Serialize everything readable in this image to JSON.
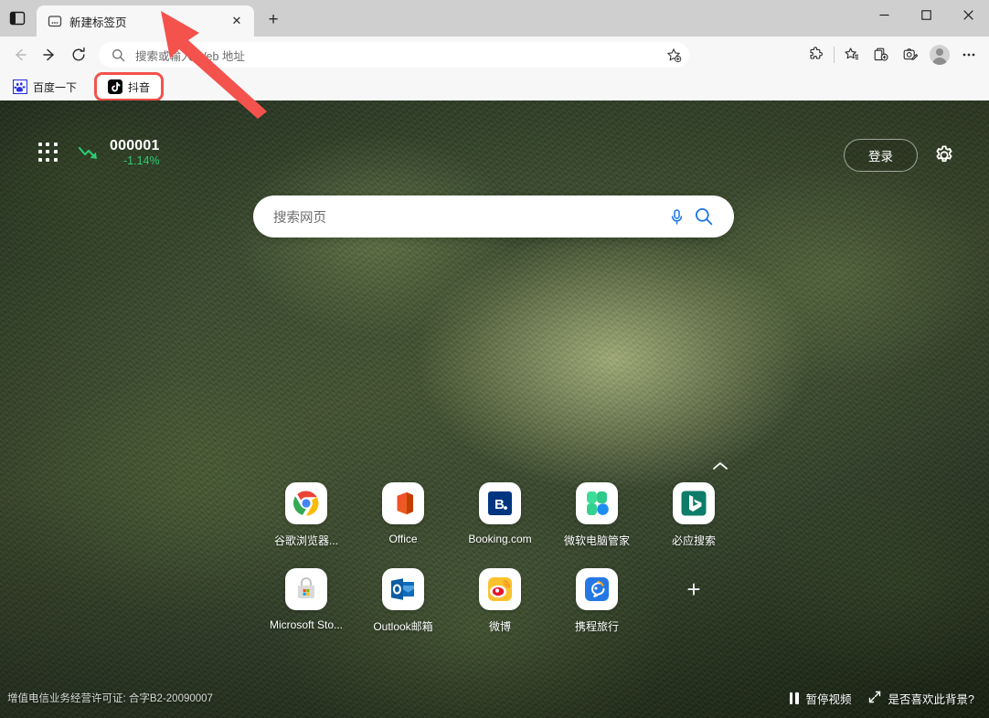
{
  "window": {
    "minimize_label": "–",
    "maximize_label": "□",
    "close_label": "✕"
  },
  "tabstrip": {
    "tab_search_icon": "tab-actions-icon",
    "tabs": [
      {
        "title": "新建标签页",
        "favicon": "new-tab-page-icon",
        "close_label": "✕"
      }
    ],
    "new_tab_label": "+"
  },
  "toolbar": {
    "back_icon": "back-arrow-icon",
    "forward_icon": "forward-arrow-icon",
    "refresh_icon": "refresh-icon",
    "address": {
      "placeholder": "搜索或输入 Web 地址",
      "value": "",
      "search_icon": "search-icon",
      "favorite_icon": "add-favorite-star-icon"
    },
    "right_icons": [
      {
        "name": "extensions-icon"
      },
      {
        "name": "favorites-star-icon"
      },
      {
        "name": "collections-icon"
      },
      {
        "name": "screenshot-icon"
      },
      {
        "name": "profile-avatar"
      },
      {
        "name": "settings-more-icon",
        "label": "⋯"
      }
    ]
  },
  "bookmarks": [
    {
      "label": "百度一下",
      "icon": "baidu-icon",
      "highlighted": false
    },
    {
      "label": "抖音",
      "icon": "douyin-icon",
      "highlighted": true
    }
  ],
  "newtab": {
    "app_grid_icon": "app-grid-icon",
    "ticker": {
      "symbol": "000001",
      "change": "-1.14%",
      "trend": "down",
      "trend_color": "#2ecc71"
    },
    "sign_in_label": "登录",
    "settings_icon": "gear-icon",
    "search": {
      "placeholder": "搜索网页",
      "value": "",
      "mic_icon": "microphone-icon",
      "search_icon": "search-icon",
      "accent_color": "#1a73e8"
    },
    "collapse_icon": "chevron-up-icon",
    "shortcuts": [
      {
        "label": "谷歌浏览器...",
        "icon": "chrome-icon"
      },
      {
        "label": "Office",
        "icon": "office-icon"
      },
      {
        "label": "Booking.com",
        "icon": "booking-icon"
      },
      {
        "label": "微软电脑管家",
        "icon": "microsoft-pc-manager-icon"
      },
      {
        "label": "必应搜索",
        "icon": "bing-icon"
      },
      {
        "label": "Microsoft Sto...",
        "icon": "microsoft-store-icon"
      },
      {
        "label": "Outlook邮箱",
        "icon": "outlook-icon"
      },
      {
        "label": "微博",
        "icon": "weibo-icon"
      },
      {
        "label": "携程旅行",
        "icon": "ctrip-icon"
      }
    ],
    "add_shortcut_label": "+",
    "license_text": "增值电信业务经营许可证: 合字B2-20090007",
    "pause_video_label": "暂停视频",
    "like_background_label": "是否喜欢此背景?"
  },
  "annotations": {
    "highlight_color": "#f4524d",
    "arrow_color": "#f4524d",
    "arrow_target": "抖音"
  }
}
